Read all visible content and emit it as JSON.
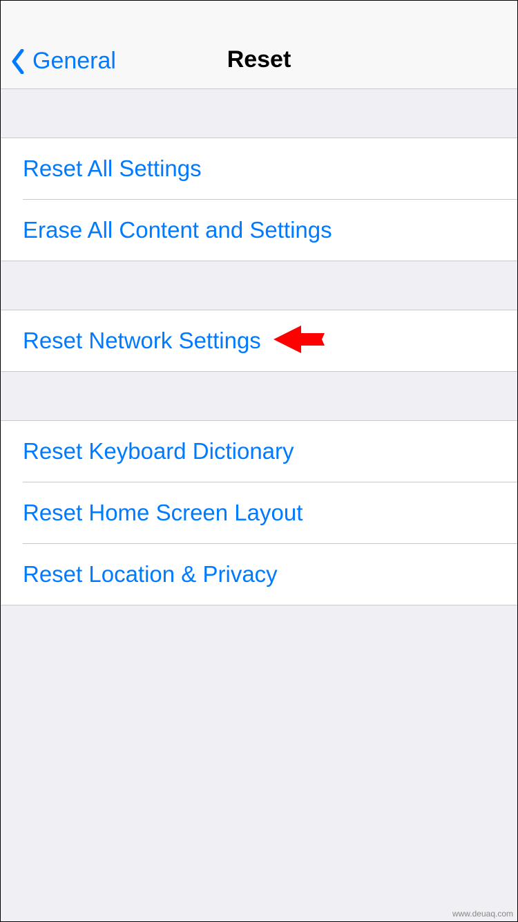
{
  "navbar": {
    "back_label": "General",
    "title": "Reset"
  },
  "groups": [
    {
      "items": [
        {
          "label": "Reset All Settings"
        },
        {
          "label": "Erase All Content and Settings"
        }
      ]
    },
    {
      "items": [
        {
          "label": "Reset Network Settings"
        }
      ]
    },
    {
      "items": [
        {
          "label": "Reset Keyboard Dictionary"
        },
        {
          "label": "Reset Home Screen Layout"
        },
        {
          "label": "Reset Location & Privacy"
        }
      ]
    }
  ],
  "annotation": {
    "points_to": "Reset Network Settings",
    "color": "#ff0000"
  },
  "watermark": "www.deuaq.com"
}
